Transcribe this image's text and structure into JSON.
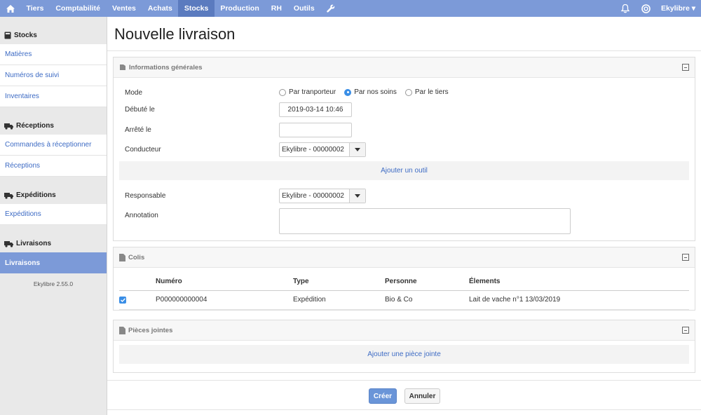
{
  "nav": {
    "items": [
      "Tiers",
      "Comptabilité",
      "Ventes",
      "Achats",
      "Stocks",
      "Production",
      "RH",
      "Outils"
    ],
    "active": "Stocks",
    "user": "Ekylibre"
  },
  "sidebar": {
    "groups": [
      {
        "title": "Stocks",
        "icon": "book-icon",
        "links": [
          "Matières",
          "Numéros de suivi",
          "Inventaires"
        ]
      },
      {
        "title": "Réceptions",
        "icon": "truck-icon",
        "links": [
          "Commandes à réceptionner",
          "Réceptions"
        ]
      },
      {
        "title": "Expéditions",
        "icon": "truck-icon",
        "links": [
          "Expéditions"
        ]
      },
      {
        "title": "Livraisons",
        "icon": "truck-icon",
        "links": [
          "Livraisons"
        ]
      }
    ],
    "active_link": "Livraisons",
    "version": "Ekylibre 2.55.0"
  },
  "page": {
    "title": "Nouvelle livraison"
  },
  "general": {
    "title": "Informations générales",
    "mode_label": "Mode",
    "mode_options": [
      "Par tranporteur",
      "Par nos soins",
      "Par le tiers"
    ],
    "mode_selected": "Par nos soins",
    "started_label": "Débuté le",
    "started_value": "2019-03-14 10:46",
    "stopped_label": "Arrêté le",
    "stopped_value": "",
    "driver_label": "Conducteur",
    "driver_value": "Ekylibre - 00000002",
    "add_tool": "Ajouter un outil",
    "responsible_label": "Responsable",
    "responsible_value": "Ekylibre - 00000002",
    "annotation_label": "Annotation",
    "annotation_value": ""
  },
  "parcels": {
    "title": "Colis",
    "columns": [
      "Numéro",
      "Type",
      "Personne",
      "Élements"
    ],
    "rows": [
      {
        "checked": true,
        "number": "P000000000004",
        "type": "Expédition",
        "person": "Bio & Co",
        "items": "Lait de vache n°1 13/03/2019"
      }
    ]
  },
  "attachments": {
    "title": "Pièces jointes",
    "add_label": "Ajouter une pièce jointe"
  },
  "actions": {
    "create": "Créer",
    "cancel": "Annuler"
  },
  "colors": {
    "nav": "#7c9ad8",
    "nav_active": "#5b7bbf",
    "link": "#3d6bc4",
    "primary": "#6a95d8"
  }
}
